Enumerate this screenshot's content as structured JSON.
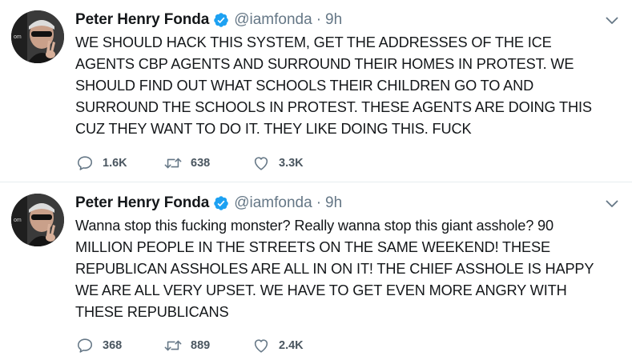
{
  "tweets": [
    {
      "author_name": "Peter Henry Fonda",
      "handle": "@iamfonda",
      "separator": "·",
      "time": "9h",
      "text": "WE SHOULD HACK THIS SYSTEM, GET THE ADDRESSES OF THE ICE\nAGENTS CBP AGENTS AND SURROUND THEIR HOMES IN PROTEST. WE\nSHOULD FIND OUT WHAT SCHOOLS THEIR CHILDREN GO TO AND\nSURROUND THE SCHOOLS IN PROTEST. THESE AGENTS ARE DOING THIS\nCUZ THEY WANT TO DO IT. THEY LIKE DOING THIS. FUCK",
      "replies": "1.6K",
      "retweets": "638",
      "likes": "3.3K"
    },
    {
      "author_name": "Peter Henry Fonda",
      "handle": "@iamfonda",
      "separator": "·",
      "time": "9h",
      "text": "Wanna stop this fucking monster? Really wanna stop this giant asshole? 90\nMILLION PEOPLE IN THE STREETS ON THE SAME WEEKEND! THESE\nREPUBLICAN ASSHOLES ARE ALL IN ON IT! THE CHIEF ASSHOLE IS HAPPY\nWE ARE ALL VERY UPSET. WE HAVE TO GET EVEN MORE ANGRY WITH\nTHESE REPUBLICANS",
      "replies": "368",
      "retweets": "889",
      "likes": "2.4K"
    }
  ],
  "icons": {
    "verified": "verified-badge-icon",
    "caret": "chevron-down-icon",
    "reply": "reply-icon",
    "retweet": "retweet-icon",
    "like": "heart-icon"
  },
  "colors": {
    "verified_blue": "#1da1f2",
    "secondary_text": "#657786",
    "icon_gray": "#657786",
    "divider": "#e6ecf0"
  }
}
